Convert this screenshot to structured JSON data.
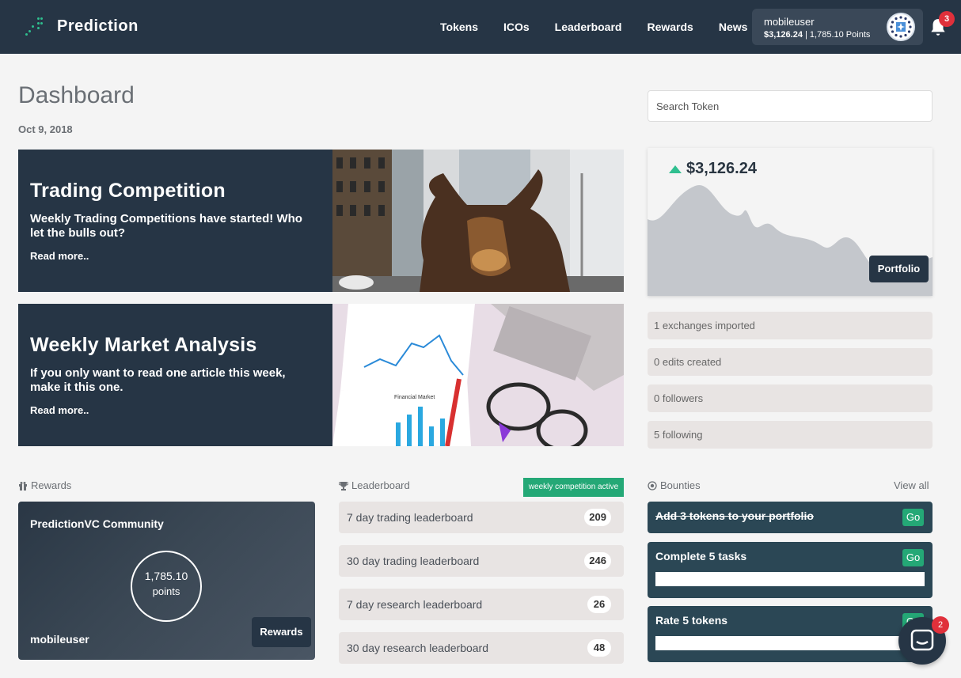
{
  "nav": {
    "brand": "Prediction",
    "links": [
      "Tokens",
      "ICOs",
      "Leaderboard",
      "Rewards",
      "News"
    ],
    "user": {
      "name": "mobileuser",
      "balance": "$3,126.24",
      "separator": "|",
      "points": "1,785.10 Points"
    },
    "notifications": "3"
  },
  "header": {
    "title": "Dashboard",
    "date": "Oct 9, 2018"
  },
  "search": {
    "placeholder": "Search Token"
  },
  "features": [
    {
      "title": "Trading Competition",
      "subtitle": "Weekly Trading Competitions have started! Who let the bulls out?",
      "link": "Read more.."
    },
    {
      "title": "Weekly Market Analysis",
      "subtitle": "If you only want to read one article this week, make it this one.",
      "link": "Read more.."
    }
  ],
  "feature_image_text": "Financial Market",
  "portfolio": {
    "value": "$3,126.24",
    "button": "Portfolio",
    "trend": "up"
  },
  "stats": [
    "1 exchanges imported",
    "0 edits created",
    "0 followers",
    "5 following"
  ],
  "rewards": {
    "heading": "Rewards",
    "community": "PredictionVC Community",
    "points": "1,785.10",
    "points_unit": "points",
    "user": "mobileuser",
    "button": "Rewards"
  },
  "leaderboard": {
    "heading": "Leaderboard",
    "badge": "weekly competition active",
    "items": [
      {
        "label": "7 day trading leaderboard",
        "count": "209"
      },
      {
        "label": "30 day trading leaderboard",
        "count": "246"
      },
      {
        "label": "7 day research leaderboard",
        "count": "26"
      },
      {
        "label": "30 day research leaderboard",
        "count": "48"
      }
    ]
  },
  "bounties": {
    "heading": "Bounties",
    "view_all": "View all",
    "items": [
      {
        "title": "Add 3 tokens to your portfolio",
        "go": "Go",
        "completed": true
      },
      {
        "title": "Complete 5 tasks",
        "go": "Go",
        "completed": false
      },
      {
        "title": "Rate 5 tokens",
        "go": "Go",
        "completed": false
      }
    ]
  },
  "chat": {
    "unread": "2"
  },
  "colors": {
    "navy": "#263545",
    "green": "#2fbf8f",
    "badge_red": "#e0303b",
    "bounty_bg": "#2b4755"
  }
}
